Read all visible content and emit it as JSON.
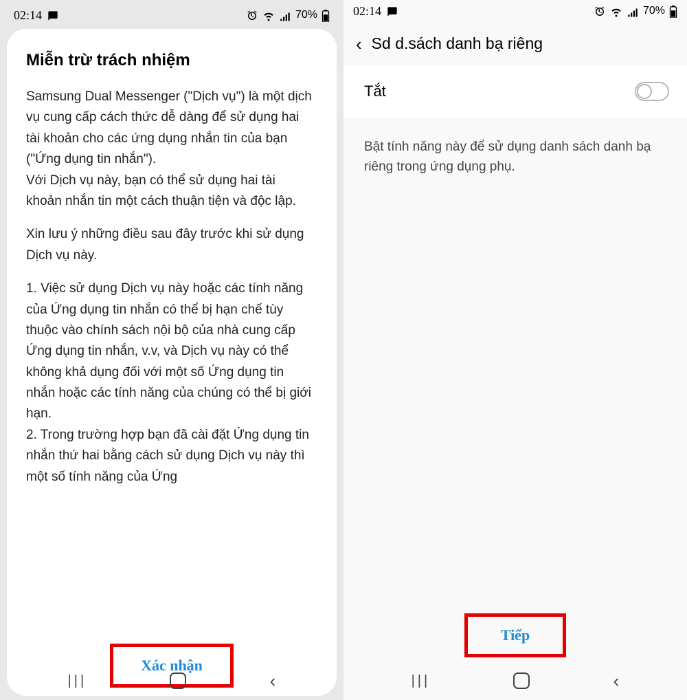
{
  "status": {
    "time": "02:14",
    "battery": "70%"
  },
  "left": {
    "title": "Miễn trừ trách nhiệm",
    "para1": "Samsung Dual Messenger (\"Dịch vụ\") là một dịch vụ cung cấp cách thức dễ dàng để sử dụng hai tài khoản cho các ứng dụng nhắn tin của bạn (\"Ứng dụng tin nhắn\").",
    "para2": "Với Dịch vụ này, bạn có thể sử dụng hai tài khoản nhắn tin một cách thuận tiện và độc lập.",
    "para3": "Xin lưu ý những điều sau đây trước khi sử dụng Dịch vụ này.",
    "para4": "1. Việc sử dụng Dịch vụ này hoặc các tính năng của Ứng dụng tin nhắn có thể bị hạn chế tùy thuộc vào chính sách nội bộ của nhà cung cấp Ứng dụng tin nhắn, v.v, và Dịch vụ này có thể không khả dụng đối với một số Ứng dụng tin nhắn hoặc các tính năng của chúng có thể bị giới hạn.",
    "para5": "2. Trong trường hợp bạn đã cài đặt Ứng dụng tin nhắn thứ hai bằng cách sử dụng Dịch vụ này thì một số tính năng của Ứng",
    "confirm_label": "Xác nhận"
  },
  "right": {
    "header_title": "Sd d.sách danh bạ riêng",
    "toggle_label": "Tắt",
    "description": "Bật tính năng này để sử dụng danh sách danh bạ riêng trong ứng dụng phụ.",
    "next_label": "Tiếp"
  }
}
